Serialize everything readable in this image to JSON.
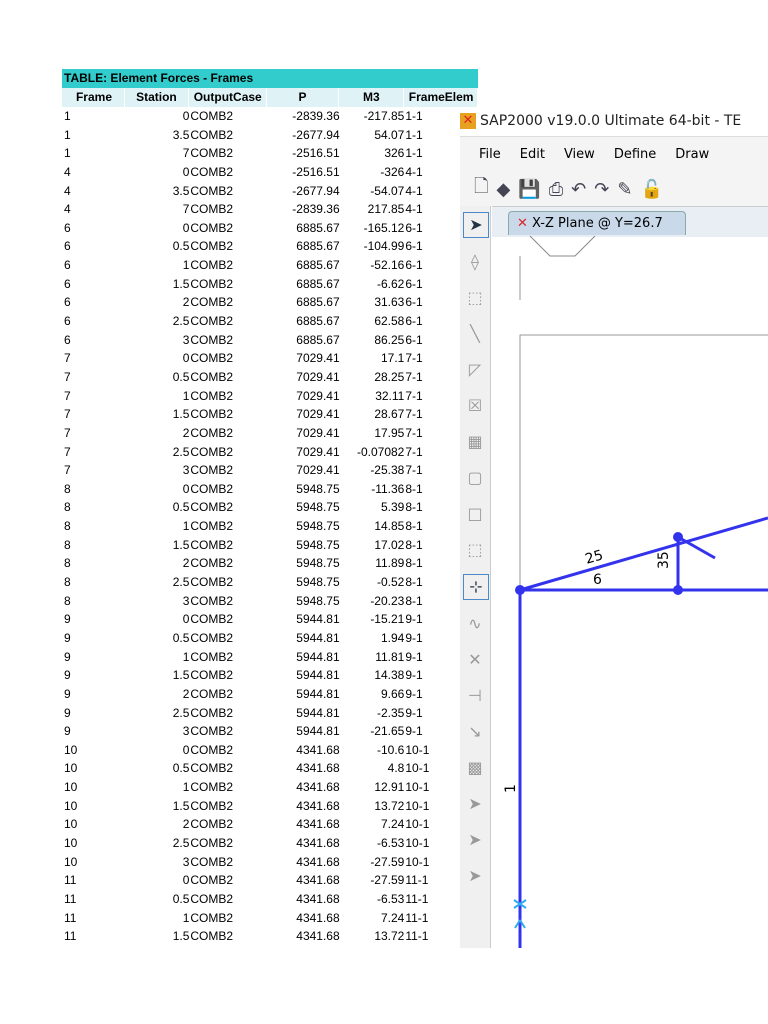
{
  "table": {
    "title": "TABLE:  Element Forces - Frames",
    "headers": [
      "Frame",
      "Station",
      "OutputCase",
      "P",
      "M3",
      "FrameElem"
    ],
    "rows": [
      [
        "1",
        "0",
        "COMB2",
        "-2839.36",
        "-217.85",
        "1-1"
      ],
      [
        "1",
        "3.5",
        "COMB2",
        "-2677.94",
        "54.07",
        "1-1"
      ],
      [
        "1",
        "7",
        "COMB2",
        "-2516.51",
        "326",
        "1-1"
      ],
      [
        "4",
        "0",
        "COMB2",
        "-2516.51",
        "-326",
        "4-1"
      ],
      [
        "4",
        "3.5",
        "COMB2",
        "-2677.94",
        "-54.07",
        "4-1"
      ],
      [
        "4",
        "7",
        "COMB2",
        "-2839.36",
        "217.85",
        "4-1"
      ],
      [
        "6",
        "0",
        "COMB2",
        "6885.67",
        "-165.12",
        "6-1"
      ],
      [
        "6",
        "0.5",
        "COMB2",
        "6885.67",
        "-104.99",
        "6-1"
      ],
      [
        "6",
        "1",
        "COMB2",
        "6885.67",
        "-52.16",
        "6-1"
      ],
      [
        "6",
        "1.5",
        "COMB2",
        "6885.67",
        "-6.62",
        "6-1"
      ],
      [
        "6",
        "2",
        "COMB2",
        "6885.67",
        "31.63",
        "6-1"
      ],
      [
        "6",
        "2.5",
        "COMB2",
        "6885.67",
        "62.58",
        "6-1"
      ],
      [
        "6",
        "3",
        "COMB2",
        "6885.67",
        "86.25",
        "6-1"
      ],
      [
        "7",
        "0",
        "COMB2",
        "7029.41",
        "17.1",
        "7-1"
      ],
      [
        "7",
        "0.5",
        "COMB2",
        "7029.41",
        "28.25",
        "7-1"
      ],
      [
        "7",
        "1",
        "COMB2",
        "7029.41",
        "32.11",
        "7-1"
      ],
      [
        "7",
        "1.5",
        "COMB2",
        "7029.41",
        "28.67",
        "7-1"
      ],
      [
        "7",
        "2",
        "COMB2",
        "7029.41",
        "17.95",
        "7-1"
      ],
      [
        "7",
        "2.5",
        "COMB2",
        "7029.41",
        "-0.07082",
        "7-1"
      ],
      [
        "7",
        "3",
        "COMB2",
        "7029.41",
        "-25.38",
        "7-1"
      ],
      [
        "8",
        "0",
        "COMB2",
        "5948.75",
        "-11.36",
        "8-1"
      ],
      [
        "8",
        "0.5",
        "COMB2",
        "5948.75",
        "5.39",
        "8-1"
      ],
      [
        "8",
        "1",
        "COMB2",
        "5948.75",
        "14.85",
        "8-1"
      ],
      [
        "8",
        "1.5",
        "COMB2",
        "5948.75",
        "17.02",
        "8-1"
      ],
      [
        "8",
        "2",
        "COMB2",
        "5948.75",
        "11.89",
        "8-1"
      ],
      [
        "8",
        "2.5",
        "COMB2",
        "5948.75",
        "-0.52",
        "8-1"
      ],
      [
        "8",
        "3",
        "COMB2",
        "5948.75",
        "-20.23",
        "8-1"
      ],
      [
        "9",
        "0",
        "COMB2",
        "5944.81",
        "-15.21",
        "9-1"
      ],
      [
        "9",
        "0.5",
        "COMB2",
        "5944.81",
        "1.94",
        "9-1"
      ],
      [
        "9",
        "1",
        "COMB2",
        "5944.81",
        "11.81",
        "9-1"
      ],
      [
        "9",
        "1.5",
        "COMB2",
        "5944.81",
        "14.38",
        "9-1"
      ],
      [
        "9",
        "2",
        "COMB2",
        "5944.81",
        "9.66",
        "9-1"
      ],
      [
        "9",
        "2.5",
        "COMB2",
        "5944.81",
        "-2.35",
        "9-1"
      ],
      [
        "9",
        "3",
        "COMB2",
        "5944.81",
        "-21.65",
        "9-1"
      ],
      [
        "10",
        "0",
        "COMB2",
        "4341.68",
        "-10.6",
        "10-1"
      ],
      [
        "10",
        "0.5",
        "COMB2",
        "4341.68",
        "4.8",
        "10-1"
      ],
      [
        "10",
        "1",
        "COMB2",
        "4341.68",
        "12.91",
        "10-1"
      ],
      [
        "10",
        "1.5",
        "COMB2",
        "4341.68",
        "13.72",
        "10-1"
      ],
      [
        "10",
        "2",
        "COMB2",
        "4341.68",
        "7.24",
        "10-1"
      ],
      [
        "10",
        "2.5",
        "COMB2",
        "4341.68",
        "-6.53",
        "10-1"
      ],
      [
        "10",
        "3",
        "COMB2",
        "4341.68",
        "-27.59",
        "10-1"
      ],
      [
        "11",
        "0",
        "COMB2",
        "4341.68",
        "-27.59",
        "11-1"
      ],
      [
        "11",
        "0.5",
        "COMB2",
        "4341.68",
        "-6.53",
        "11-1"
      ],
      [
        "11",
        "1",
        "COMB2",
        "4341.68",
        "7.24",
        "11-1"
      ],
      [
        "11",
        "1.5",
        "COMB2",
        "4341.68",
        "13.72",
        "11-1"
      ]
    ]
  },
  "sap": {
    "title": "SAP2000 v19.0.0 Ultimate 64-bit - TE",
    "menu": [
      "File",
      "Edit",
      "View",
      "Define",
      "Draw"
    ],
    "tab": "X-Z Plane @ Y=26.7",
    "labels": {
      "a": "25",
      "b": "6",
      "c": "35",
      "d": "1"
    }
  }
}
